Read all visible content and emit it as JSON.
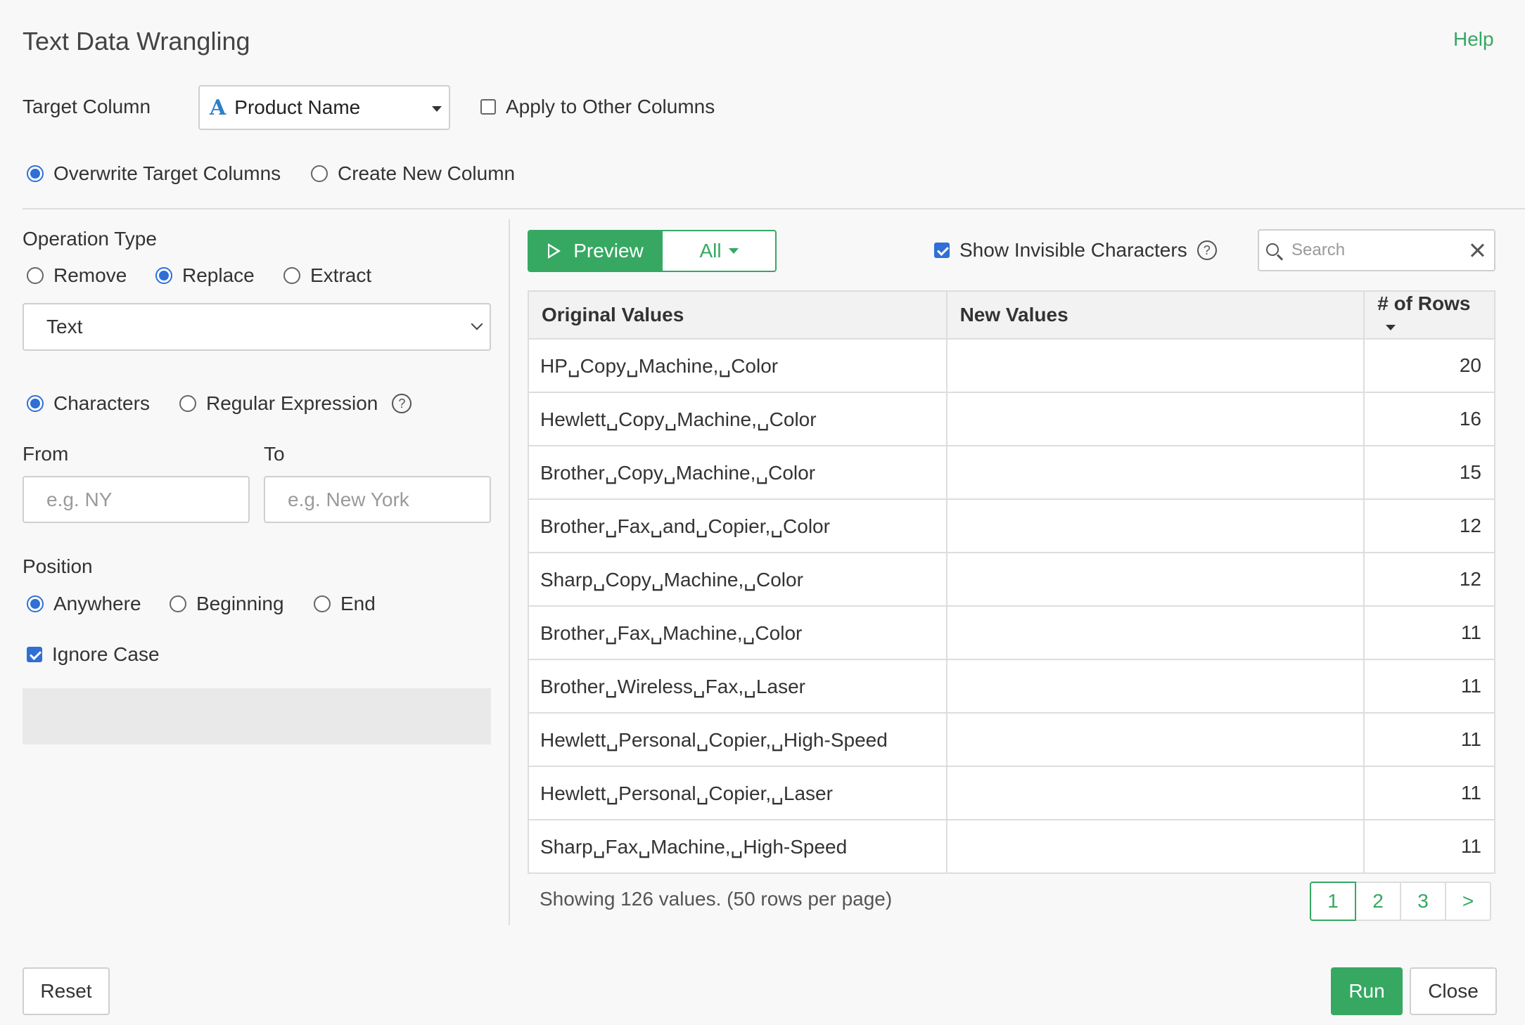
{
  "dialog": {
    "title": "Text Data Wrangling",
    "help_label": "Help"
  },
  "target": {
    "label": "Target Column",
    "type_icon": "A",
    "selected": "Product Name",
    "apply_other_label": "Apply to Other Columns",
    "apply_other_checked": false
  },
  "output_mode": {
    "options": [
      "Overwrite Target Columns",
      "Create New Column"
    ],
    "selected": "Overwrite Target Columns"
  },
  "operation": {
    "label": "Operation Type",
    "options": [
      "Remove",
      "Replace",
      "Extract"
    ],
    "selected": "Replace",
    "type_select_value": "Text",
    "match_options": [
      "Characters",
      "Regular Expression"
    ],
    "match_selected": "Characters",
    "help_glyph": "?"
  },
  "from_to": {
    "from_label": "From",
    "to_label": "To",
    "from_placeholder": "e.g. NY",
    "to_placeholder": "e.g. New York"
  },
  "position": {
    "label": "Position",
    "options": [
      "Anywhere",
      "Beginning",
      "End"
    ],
    "selected": "Anywhere"
  },
  "ignore_case": {
    "label": "Ignore Case",
    "checked": true
  },
  "preview": {
    "preview_label": "Preview",
    "filter_label": "All",
    "show_invisible_label": "Show Invisible Characters",
    "show_invisible_checked": true,
    "search_placeholder": "Search"
  },
  "table": {
    "headers": [
      "Original Values",
      "New Values",
      "# of Rows"
    ],
    "rows": [
      {
        "original": "HP␣Copy␣Machine,␣Color",
        "new": "",
        "count": "20"
      },
      {
        "original": "Hewlett␣Copy␣Machine,␣Color",
        "new": "",
        "count": "16"
      },
      {
        "original": "Brother␣Copy␣Machine,␣Color",
        "new": "",
        "count": "15"
      },
      {
        "original": "Brother␣Fax␣and␣Copier,␣Color",
        "new": "",
        "count": "12"
      },
      {
        "original": "Sharp␣Copy␣Machine,␣Color",
        "new": "",
        "count": "12"
      },
      {
        "original": "Brother␣Fax␣Machine,␣Color",
        "new": "",
        "count": "11"
      },
      {
        "original": "Brother␣Wireless␣Fax,␣Laser",
        "new": "",
        "count": "11"
      },
      {
        "original": "Hewlett␣Personal␣Copier,␣High-Speed",
        "new": "",
        "count": "11"
      },
      {
        "original": "Hewlett␣Personal␣Copier,␣Laser",
        "new": "",
        "count": "11"
      },
      {
        "original": "Sharp␣Fax␣Machine,␣High-Speed",
        "new": "",
        "count": "11"
      }
    ]
  },
  "pagination": {
    "summary": "Showing 126 values. (50 rows per page)",
    "pages": [
      "1",
      "2",
      "3"
    ],
    "next_label": ">",
    "current": "1"
  },
  "footer": {
    "reset_label": "Reset",
    "run_label": "Run",
    "close_label": "Close"
  },
  "colors": {
    "accent_green": "#36a862",
    "radio_blue": "#2f6fd6",
    "column_type_blue": "#2a7fc9"
  }
}
